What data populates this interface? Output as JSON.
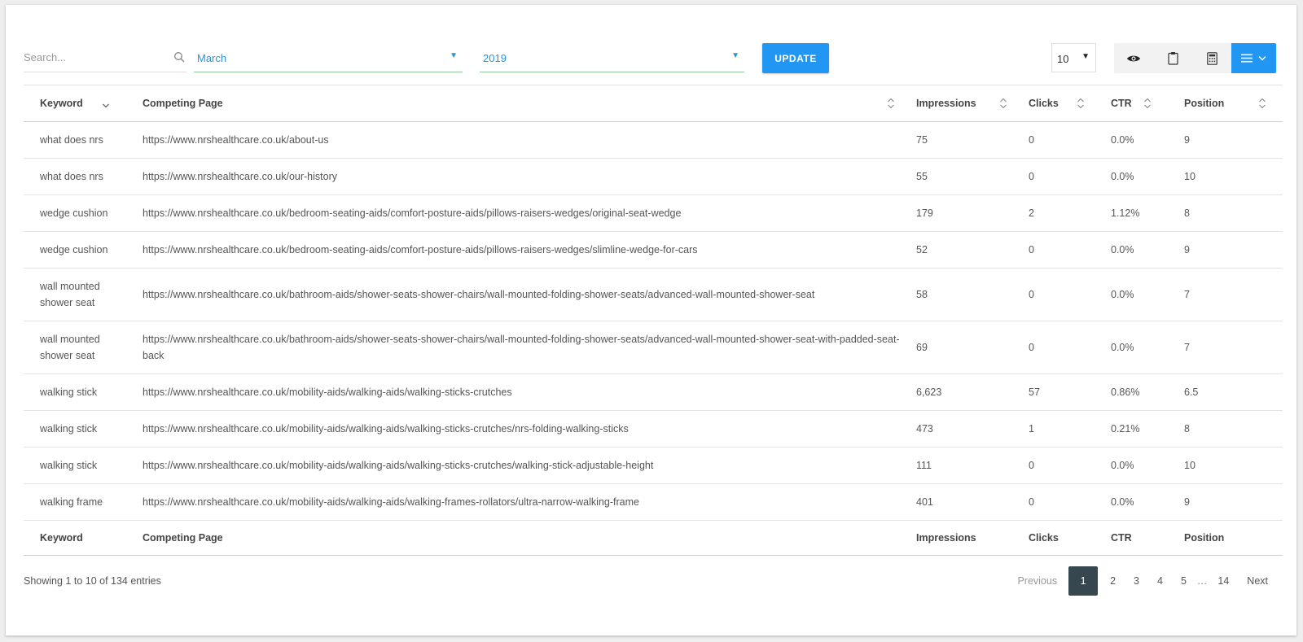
{
  "search": {
    "placeholder": "Search..."
  },
  "filters": {
    "month": "March",
    "year": "2019",
    "update_label": "UPDATE"
  },
  "page_length": "10",
  "table": {
    "headers": [
      "Keyword",
      "Competing Page",
      "Impressions",
      "Clicks",
      "CTR",
      "Position"
    ],
    "rows": [
      [
        "what does nrs",
        "https://www.nrshealthcare.co.uk/about-us",
        "75",
        "0",
        "0.0%",
        "9"
      ],
      [
        "what does nrs",
        "https://www.nrshealthcare.co.uk/our-history",
        "55",
        "0",
        "0.0%",
        "10"
      ],
      [
        "wedge cushion",
        "https://www.nrshealthcare.co.uk/bedroom-seating-aids/comfort-posture-aids/pillows-raisers-wedges/original-seat-wedge",
        "179",
        "2",
        "1.12%",
        "8"
      ],
      [
        "wedge cushion",
        "https://www.nrshealthcare.co.uk/bedroom-seating-aids/comfort-posture-aids/pillows-raisers-wedges/slimline-wedge-for-cars",
        "52",
        "0",
        "0.0%",
        "9"
      ],
      [
        "wall mounted shower seat",
        "https://www.nrshealthcare.co.uk/bathroom-aids/shower-seats-shower-chairs/wall-mounted-folding-shower-seats/advanced-wall-mounted-shower-seat",
        "58",
        "0",
        "0.0%",
        "7"
      ],
      [
        "wall mounted shower seat",
        "https://www.nrshealthcare.co.uk/bathroom-aids/shower-seats-shower-chairs/wall-mounted-folding-shower-seats/advanced-wall-mounted-shower-seat-with-padded-seat-back",
        "69",
        "0",
        "0.0%",
        "7"
      ],
      [
        "walking stick",
        "https://www.nrshealthcare.co.uk/mobility-aids/walking-aids/walking-sticks-crutches",
        "6,623",
        "57",
        "0.86%",
        "6.5"
      ],
      [
        "walking stick",
        "https://www.nrshealthcare.co.uk/mobility-aids/walking-aids/walking-sticks-crutches/nrs-folding-walking-sticks",
        "473",
        "1",
        "0.21%",
        "8"
      ],
      [
        "walking stick",
        "https://www.nrshealthcare.co.uk/mobility-aids/walking-aids/walking-sticks-crutches/walking-stick-adjustable-height",
        "111",
        "0",
        "0.0%",
        "10"
      ],
      [
        "walking frame",
        "https://www.nrshealthcare.co.uk/mobility-aids/walking-aids/walking-frames-rollators/ultra-narrow-walking-frame",
        "401",
        "0",
        "0.0%",
        "9"
      ]
    ]
  },
  "footer": {
    "info": "Showing 1 to 10 of 134 entries",
    "previous": "Previous",
    "pages": [
      "1",
      "2",
      "3",
      "4",
      "5"
    ],
    "ellipsis": "…",
    "last_page": "14",
    "next": "Next",
    "current_page": "1"
  },
  "colors": {
    "accent": "#2196f3",
    "active_page": "#37474f",
    "select_text": "#2a93d5"
  },
  "icons": [
    "search-icon",
    "eye-icon",
    "clipboard-icon",
    "calculator-icon",
    "menu-icon",
    "chevron-down-icon",
    "sort-icon"
  ]
}
